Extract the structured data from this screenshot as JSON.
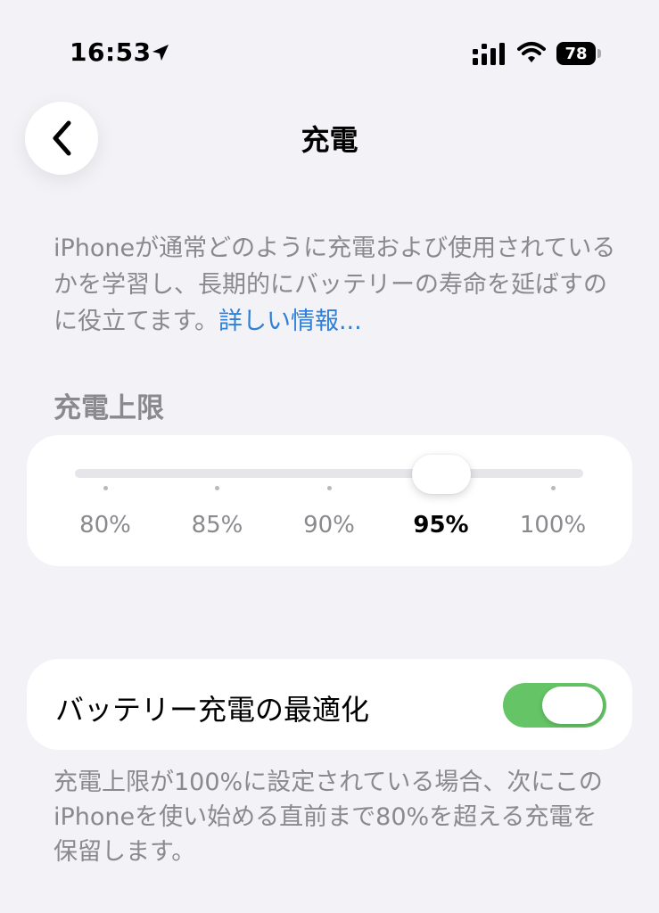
{
  "status_bar": {
    "time": "16:53",
    "battery_level": "78",
    "icons": [
      "location-arrow-icon",
      "cellular-signal-icon",
      "wifi-icon",
      "battery-icon"
    ]
  },
  "header": {
    "title": "充電",
    "back_icon": "chevron-left-icon"
  },
  "description": {
    "text": "iPhoneが通常どのように充電および使用されているかを学習し、長期的にバッテリーの寿命を延ばすのに役立てます。",
    "link_text": "詳しい情報..."
  },
  "charge_limit": {
    "section_title": "充電上限",
    "options": [
      "80%",
      "85%",
      "90%",
      "95%",
      "100%"
    ],
    "selected_index": 3,
    "selected_value": "95%"
  },
  "optimization": {
    "label": "バッテリー充電の最適化",
    "enabled": true
  },
  "footer": {
    "note": "充電上限が100%に設定されている場合、次にこのiPhoneを使い始める直前まで80%を超える充電を保留します。"
  },
  "colors": {
    "background": "#f2f2f7",
    "card": "#ffffff",
    "secondary_text": "#8a8a8e",
    "link": "#2f7ed8",
    "toggle_on": "#65c466"
  }
}
